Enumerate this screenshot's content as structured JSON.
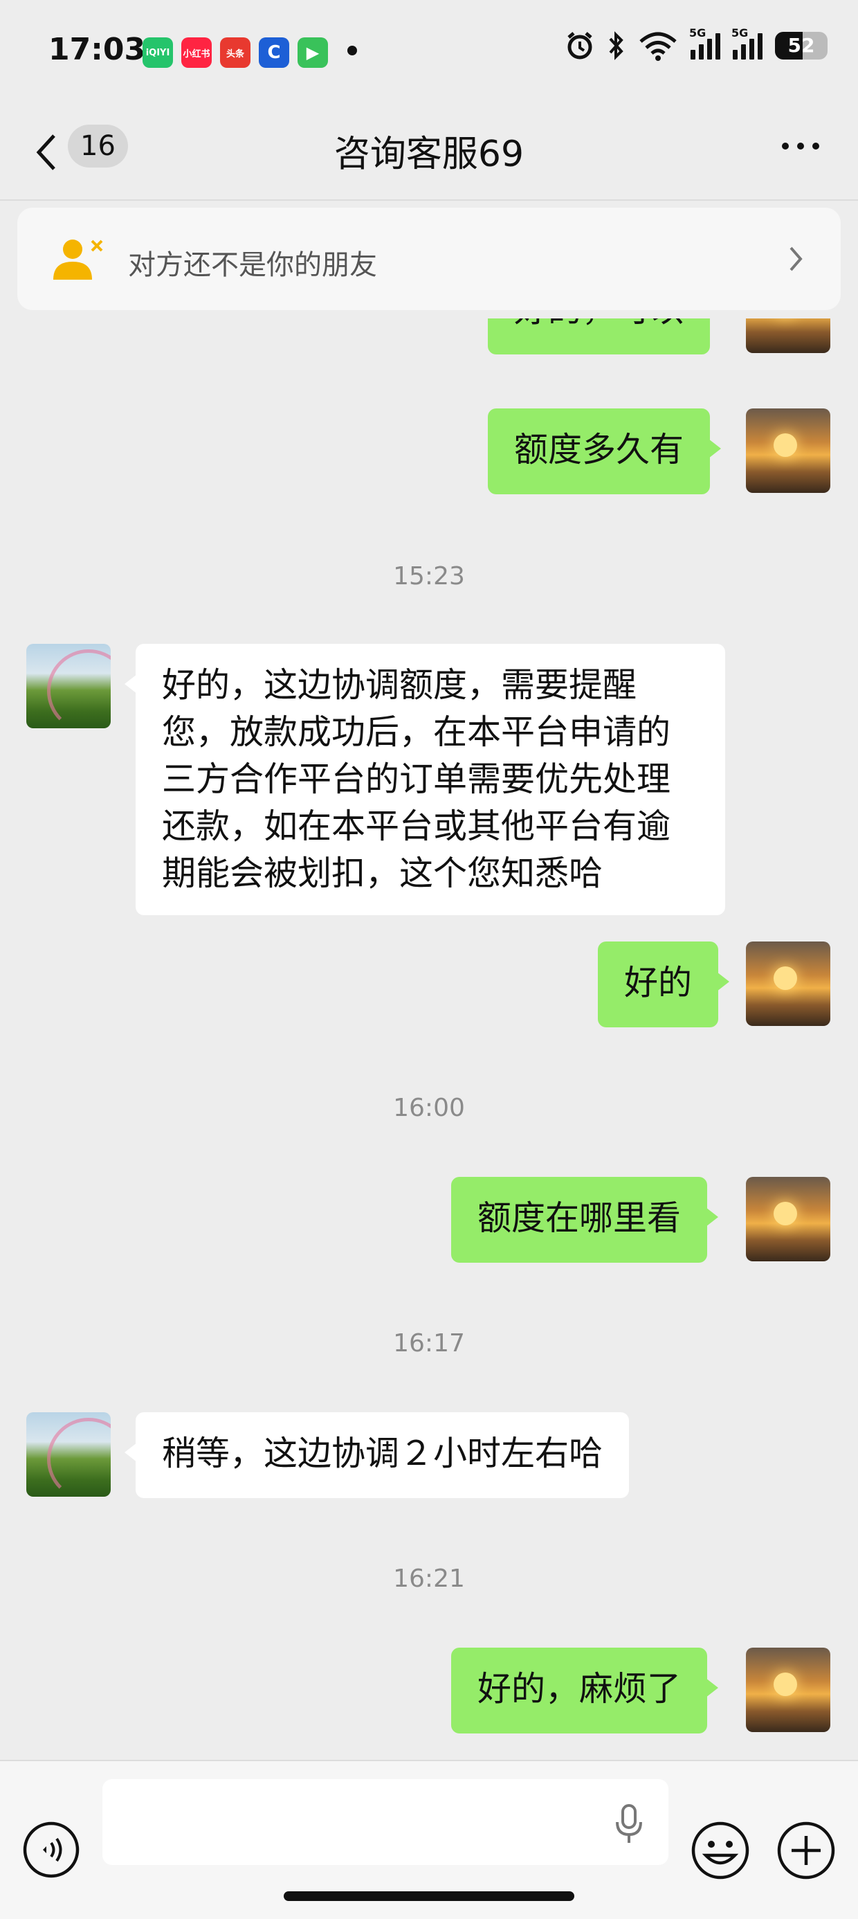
{
  "status_bar": {
    "time": "17:03",
    "apps": [
      {
        "name": "iqiyi-app-icon",
        "label": "iQIYI",
        "color": "#25c46b"
      },
      {
        "name": "xiaohongshu-app-icon",
        "label": "小红书",
        "color": "#ff2442"
      },
      {
        "name": "toutiao-app-icon",
        "label": "头条",
        "color": "#e8392f"
      },
      {
        "name": "unknown-app-icon",
        "label": "C",
        "color": "#1d5fd6"
      },
      {
        "name": "video-app-icon",
        "label": "▶",
        "color": "#39c25a"
      }
    ],
    "network_1": "5G",
    "network_2": "5G",
    "battery": "52"
  },
  "header": {
    "unread_count": "16",
    "title": "咨询客服69"
  },
  "banner": {
    "text": "对方还不是你的朋友"
  },
  "messages": [
    {
      "type": "out",
      "text": "好的，可以"
    },
    {
      "type": "out",
      "text": "额度多久有"
    },
    {
      "type": "time",
      "text": "15:23"
    },
    {
      "type": "in",
      "text": "好的，这边协调额度，需要提醒您，放款成功后，在本平台申请的三方合作平台的订单需要优先处理还款，如在本平台或其他平台有逾期能会被划扣，这个您知悉哈"
    },
    {
      "type": "out",
      "text": "好的"
    },
    {
      "type": "time",
      "text": "16:00"
    },
    {
      "type": "out",
      "text": "额度在哪里看"
    },
    {
      "type": "time",
      "text": "16:17"
    },
    {
      "type": "in",
      "text": "稍等，这边协调２小时左右哈"
    },
    {
      "type": "time",
      "text": "16:21"
    },
    {
      "type": "out",
      "text": "好的，麻烦了"
    }
  ],
  "input": {
    "value": "",
    "placeholder": ""
  },
  "colors": {
    "outgoing_bubble": "#95ec69",
    "incoming_bubble": "#ffffff",
    "background": "#ededed",
    "banner_icon": "#f5b400"
  }
}
